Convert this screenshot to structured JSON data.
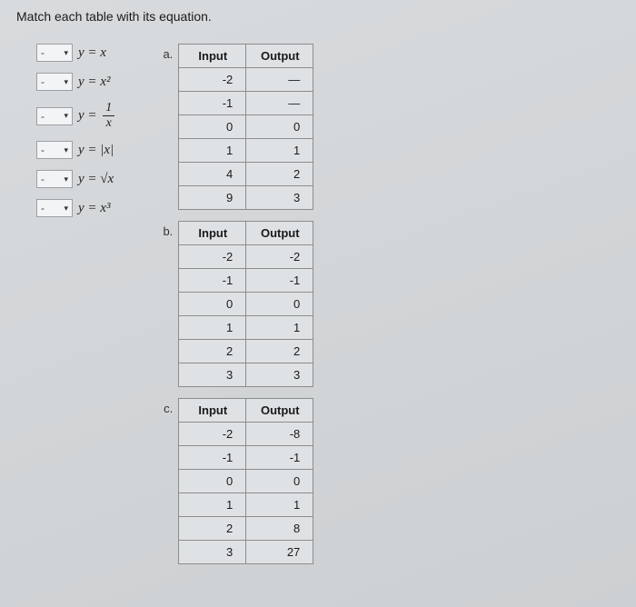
{
  "question": "Match each table with its equation.",
  "selector_placeholder": "-",
  "equations": {
    "eq1": "y = x",
    "eq2": "y = x²",
    "eq3_lhs": "y = ",
    "eq3_num": "1",
    "eq3_den": "x",
    "eq4": "y = |x|",
    "eq5": "y = √x",
    "eq6": "y = x³"
  },
  "labels": {
    "a": "a.",
    "b": "b.",
    "c": "c."
  },
  "headers": {
    "input": "Input",
    "output": "Output"
  },
  "tables": {
    "a": {
      "rows": [
        {
          "in": "-2",
          "out": "—"
        },
        {
          "in": "-1",
          "out": "—"
        },
        {
          "in": "0",
          "out": "0"
        },
        {
          "in": "1",
          "out": "1"
        },
        {
          "in": "4",
          "out": "2"
        },
        {
          "in": "9",
          "out": "3"
        }
      ]
    },
    "b": {
      "rows": [
        {
          "in": "-2",
          "out": "-2"
        },
        {
          "in": "-1",
          "out": "-1"
        },
        {
          "in": "0",
          "out": "0"
        },
        {
          "in": "1",
          "out": "1"
        },
        {
          "in": "2",
          "out": "2"
        },
        {
          "in": "3",
          "out": "3"
        }
      ]
    },
    "c": {
      "rows": [
        {
          "in": "-2",
          "out": "-8"
        },
        {
          "in": "-1",
          "out": "-1"
        },
        {
          "in": "0",
          "out": "0"
        },
        {
          "in": "1",
          "out": "1"
        },
        {
          "in": "2",
          "out": "8"
        },
        {
          "in": "3",
          "out": "27"
        }
      ]
    }
  }
}
